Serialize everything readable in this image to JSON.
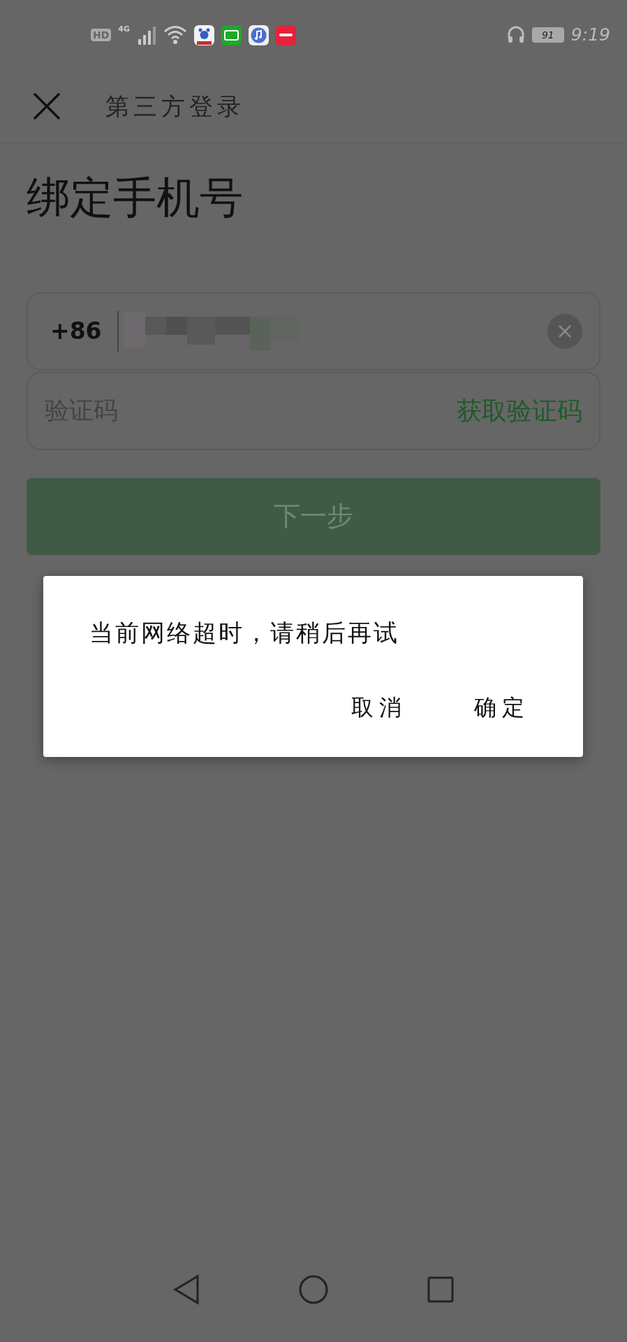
{
  "status_bar": {
    "hd": "HD",
    "network": "4G",
    "battery": "91",
    "time": "9:19"
  },
  "header": {
    "title": "第三方登录"
  },
  "page_title": "绑定手机号",
  "phone_field": {
    "country_code": "+86"
  },
  "code_field": {
    "placeholder": "验证码",
    "action": "获取验证码"
  },
  "next_button": {
    "label": "下一步",
    "disabled": true
  },
  "dialog": {
    "message": "当前网络超时，请稍后再试",
    "buttons": [
      {
        "label": "取消"
      },
      {
        "label": "确定"
      }
    ]
  }
}
